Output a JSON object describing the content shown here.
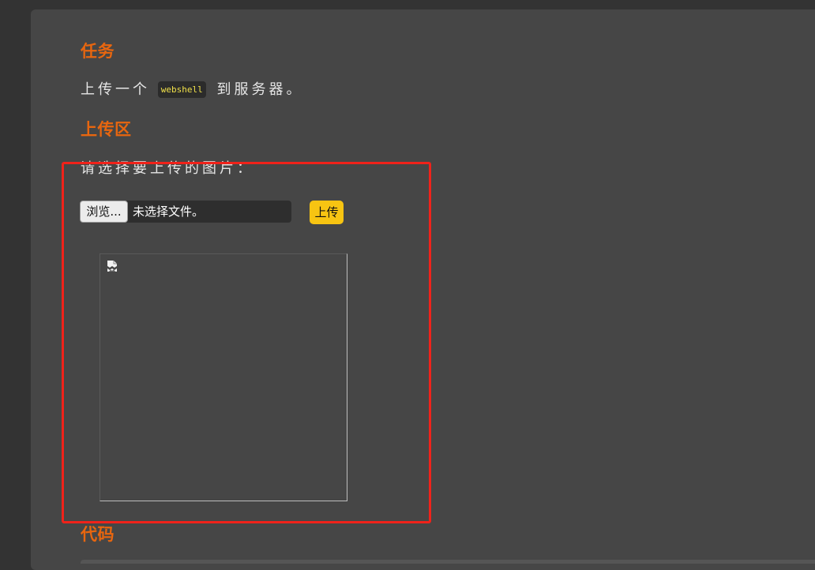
{
  "sections": {
    "task": {
      "heading": "任务",
      "text_before": "上传一个",
      "code": "webshell",
      "text_after": "到服务器。"
    },
    "upload": {
      "heading": "上传区",
      "prompt": "请选择要上传的图片：",
      "browse_label": "浏览...",
      "file_status": "未选择文件。",
      "submit_label": "上传"
    },
    "code": {
      "heading": "代码"
    }
  },
  "icons": {
    "preview": "broken-image-icon"
  },
  "colors": {
    "heading": "#e8660f",
    "submit_button": "#f7c412",
    "highlight": "#f0221a",
    "code_text": "#f0e04a"
  }
}
